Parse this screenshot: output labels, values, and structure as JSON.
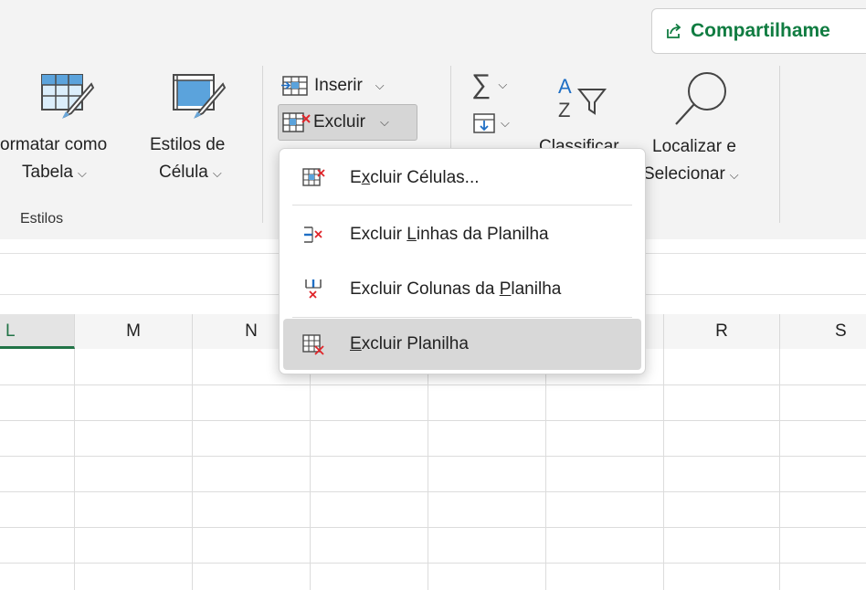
{
  "header": {
    "share_label": "Compartilhame"
  },
  "ribbon": {
    "formatar_line1": "ormatar como",
    "formatar_line2": "Tabela",
    "estilos_line1": "Estilos de",
    "estilos_line2": "Célula",
    "group_estilos": "Estilos",
    "inserir": "Inserir",
    "excluir": "Excluir",
    "classificar": "Classificar",
    "localizar_line1": "Localizar e",
    "localizar_line2": "Selecionar"
  },
  "menu": {
    "items": [
      {
        "pre": "",
        "key": "x",
        "rest": "Excluir Células...",
        "icon": "delete-cells-icon",
        "label_pre": "E",
        "label_post": "cluir Células..."
      },
      {
        "label_pre": "Excluir ",
        "key": "L",
        "label_post": "inhas da Planilha",
        "icon": "delete-rows-icon"
      },
      {
        "label_pre": "Excluir Colunas da ",
        "key": "P",
        "label_post": "lanilha",
        "icon": "delete-columns-icon"
      },
      {
        "label_pre": "",
        "key": "E",
        "label_post": "xcluir Planilha",
        "icon": "delete-sheet-icon"
      }
    ]
  },
  "grid": {
    "columns": [
      "L",
      "M",
      "N",
      "",
      "",
      "",
      "R",
      "S"
    ],
    "selected_column": "L"
  },
  "colors": {
    "accent": "#217346",
    "share": "#107c41",
    "delete": "#e0262b"
  }
}
